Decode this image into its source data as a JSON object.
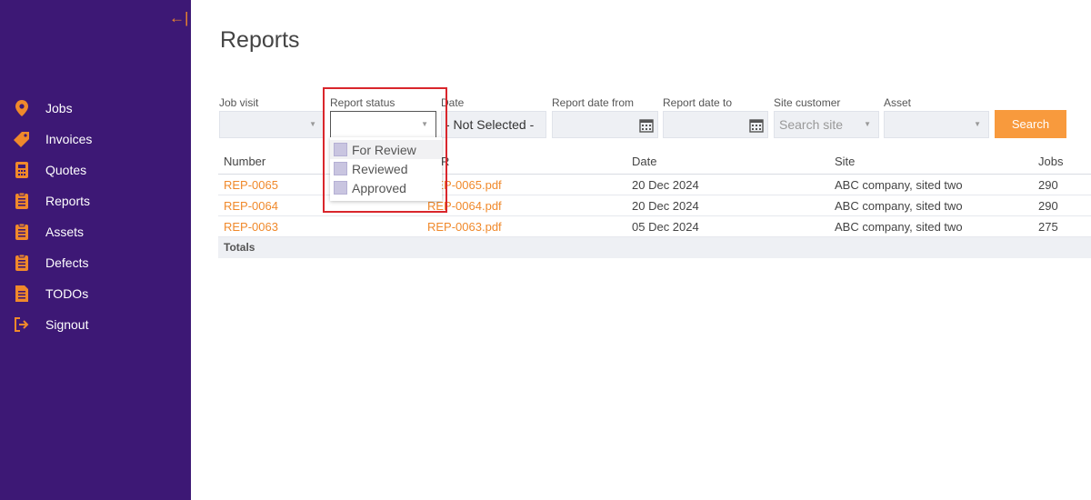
{
  "sidebar": {
    "collapse_label": "←|",
    "items": [
      {
        "label": "Jobs",
        "icon": "map-pin-icon"
      },
      {
        "label": "Invoices",
        "icon": "tag-icon"
      },
      {
        "label": "Quotes",
        "icon": "calculator-icon"
      },
      {
        "label": "Reports",
        "icon": "clipboard-icon"
      },
      {
        "label": "Assets",
        "icon": "clipboard-icon"
      },
      {
        "label": "Defects",
        "icon": "clipboard-icon"
      },
      {
        "label": "TODOs",
        "icon": "document-icon"
      },
      {
        "label": "Signout",
        "icon": "signout-icon"
      }
    ],
    "bg_color": "#3d1875",
    "accent_color": "#f0892b"
  },
  "page": {
    "title": "Reports"
  },
  "filters": {
    "job_visit": {
      "label": "Job visit",
      "value": ""
    },
    "report_status": {
      "label": "Report status",
      "value": "",
      "options": [
        "For Review",
        "Reviewed",
        "Approved"
      ]
    },
    "date": {
      "label": "Date",
      "value": "- Not Selected -"
    },
    "report_date_from": {
      "label": "Report date from",
      "value": ""
    },
    "report_date_to": {
      "label": "Report date to",
      "value": ""
    },
    "site_customer": {
      "label": "Site customer",
      "placeholder": "Search site"
    },
    "asset": {
      "label": "Asset",
      "value": ""
    },
    "search_label": "Search"
  },
  "table": {
    "columns": [
      "Number",
      "R",
      "Date",
      "Site",
      "Jobs"
    ],
    "rows": [
      {
        "number": "REP-0065",
        "file": "REP-0065.pdf",
        "date": "20 Dec 2024",
        "site": "ABC company, sited two",
        "jobs": "290"
      },
      {
        "number": "REP-0064",
        "file": "REP-0064.pdf",
        "date": "20 Dec 2024",
        "site": "ABC company, sited two",
        "jobs": "290"
      },
      {
        "number": "REP-0063",
        "file": "REP-0063.pdf",
        "date": "05 Dec 2024",
        "site": "ABC company, sited two",
        "jobs": "275"
      }
    ],
    "totals_label": "Totals"
  }
}
